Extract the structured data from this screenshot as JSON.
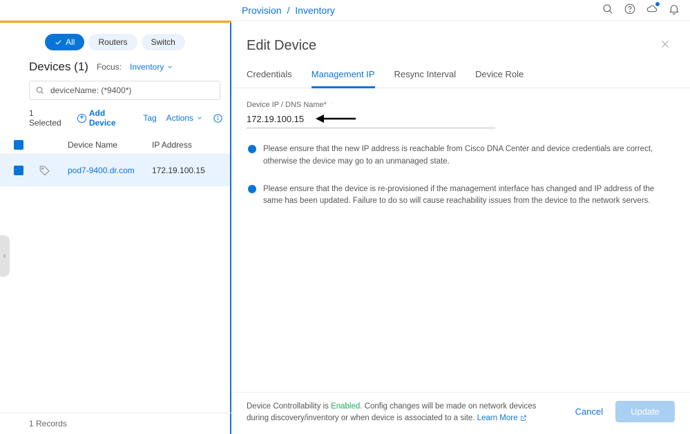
{
  "breadcrumb": {
    "part1": "Provision",
    "sep": "/",
    "part2": "Inventory"
  },
  "filters": {
    "all": "All",
    "routers": "Routers",
    "switches": "Switch"
  },
  "devices": {
    "title": "Devices (1)",
    "focus_label": "Focus:",
    "focus_value": "Inventory"
  },
  "search": {
    "text": "deviceName: (*9400*)"
  },
  "actions_row": {
    "selected": "1 Selected",
    "add": "Add Device",
    "tag": "Tag",
    "actions": "Actions"
  },
  "columns": {
    "name": "Device Name",
    "ip": "IP Address"
  },
  "rows": [
    {
      "name": "pod7-9400.dr.com",
      "ip": "172.19.100.15"
    }
  ],
  "records": "1 Records",
  "panel": {
    "title": "Edit Device",
    "tabs": {
      "credentials": "Credentials",
      "mgmt": "Management IP",
      "resync": "Resync Interval",
      "role": "Device Role"
    },
    "field_label": "Device IP / DNS Name",
    "ip_value": "172.19.100.15",
    "notice1": "Please ensure that the new IP address is reachable from Cisco DNA Center and device credentials are correct, otherwise the device may go to an unmanaged state.",
    "notice2": "Please ensure that the device is re-provisioned if the management interface has changed and IP address of the same has been updated. Failure to do so will cause reachability issues from the device to the network servers.",
    "footer_pre": "Device Controllability is ",
    "footer_enabled": "Enabled",
    "footer_post": ". Config changes will be made on network devices during discovery/inventory or when device is associated to a site. ",
    "learn": "Learn More",
    "cancel": "Cancel",
    "update": "Update"
  }
}
